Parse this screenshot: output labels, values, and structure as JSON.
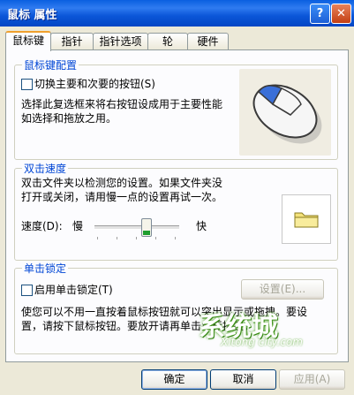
{
  "window": {
    "title": "鼠标 属性",
    "help": "?",
    "close": "✕"
  },
  "tabs": [
    {
      "label": "鼠标键",
      "active": true
    },
    {
      "label": "指针"
    },
    {
      "label": "指针选项"
    },
    {
      "label": "轮"
    },
    {
      "label": "硬件"
    }
  ],
  "button_config": {
    "title": "鼠标键配置",
    "switch_label": "切换主要和次要的按钮(S)",
    "switch_checked": false,
    "description_line1": "选择此复选框来将右按钮设成用于主要性能",
    "description_line2": "如选择和拖放之用。"
  },
  "double_click": {
    "title": "双击速度",
    "desc_line1": "双击文件夹以检测您的设置。如果文件夹没",
    "desc_line2": "打开或关闭，请用慢一点的设置再试一次。",
    "speed_label": "速度(D):",
    "slow": "慢",
    "fast": "快",
    "speed_fraction": 0.6
  },
  "click_lock": {
    "title": "单击锁定",
    "enable_label": "启用单击锁定(T)",
    "enable_checked": false,
    "settings_button": "设置(E)...",
    "desc_line1": "使您可以不用一直按着鼠标按钮就可以突出显示或拖拽。要设",
    "desc_line2": "置，请按下鼠标按钮。要放开请再单击鼠标按钮。"
  },
  "buttons": {
    "ok": "确定",
    "cancel": "取消",
    "apply": "应用(A)"
  },
  "watermark": {
    "brand": "系统城",
    "url": "Xitong city.com"
  },
  "colors": {
    "title_bar": "#0a5fe0",
    "group_title": "#0046d5",
    "tab_highlight": "#f0a02c"
  }
}
